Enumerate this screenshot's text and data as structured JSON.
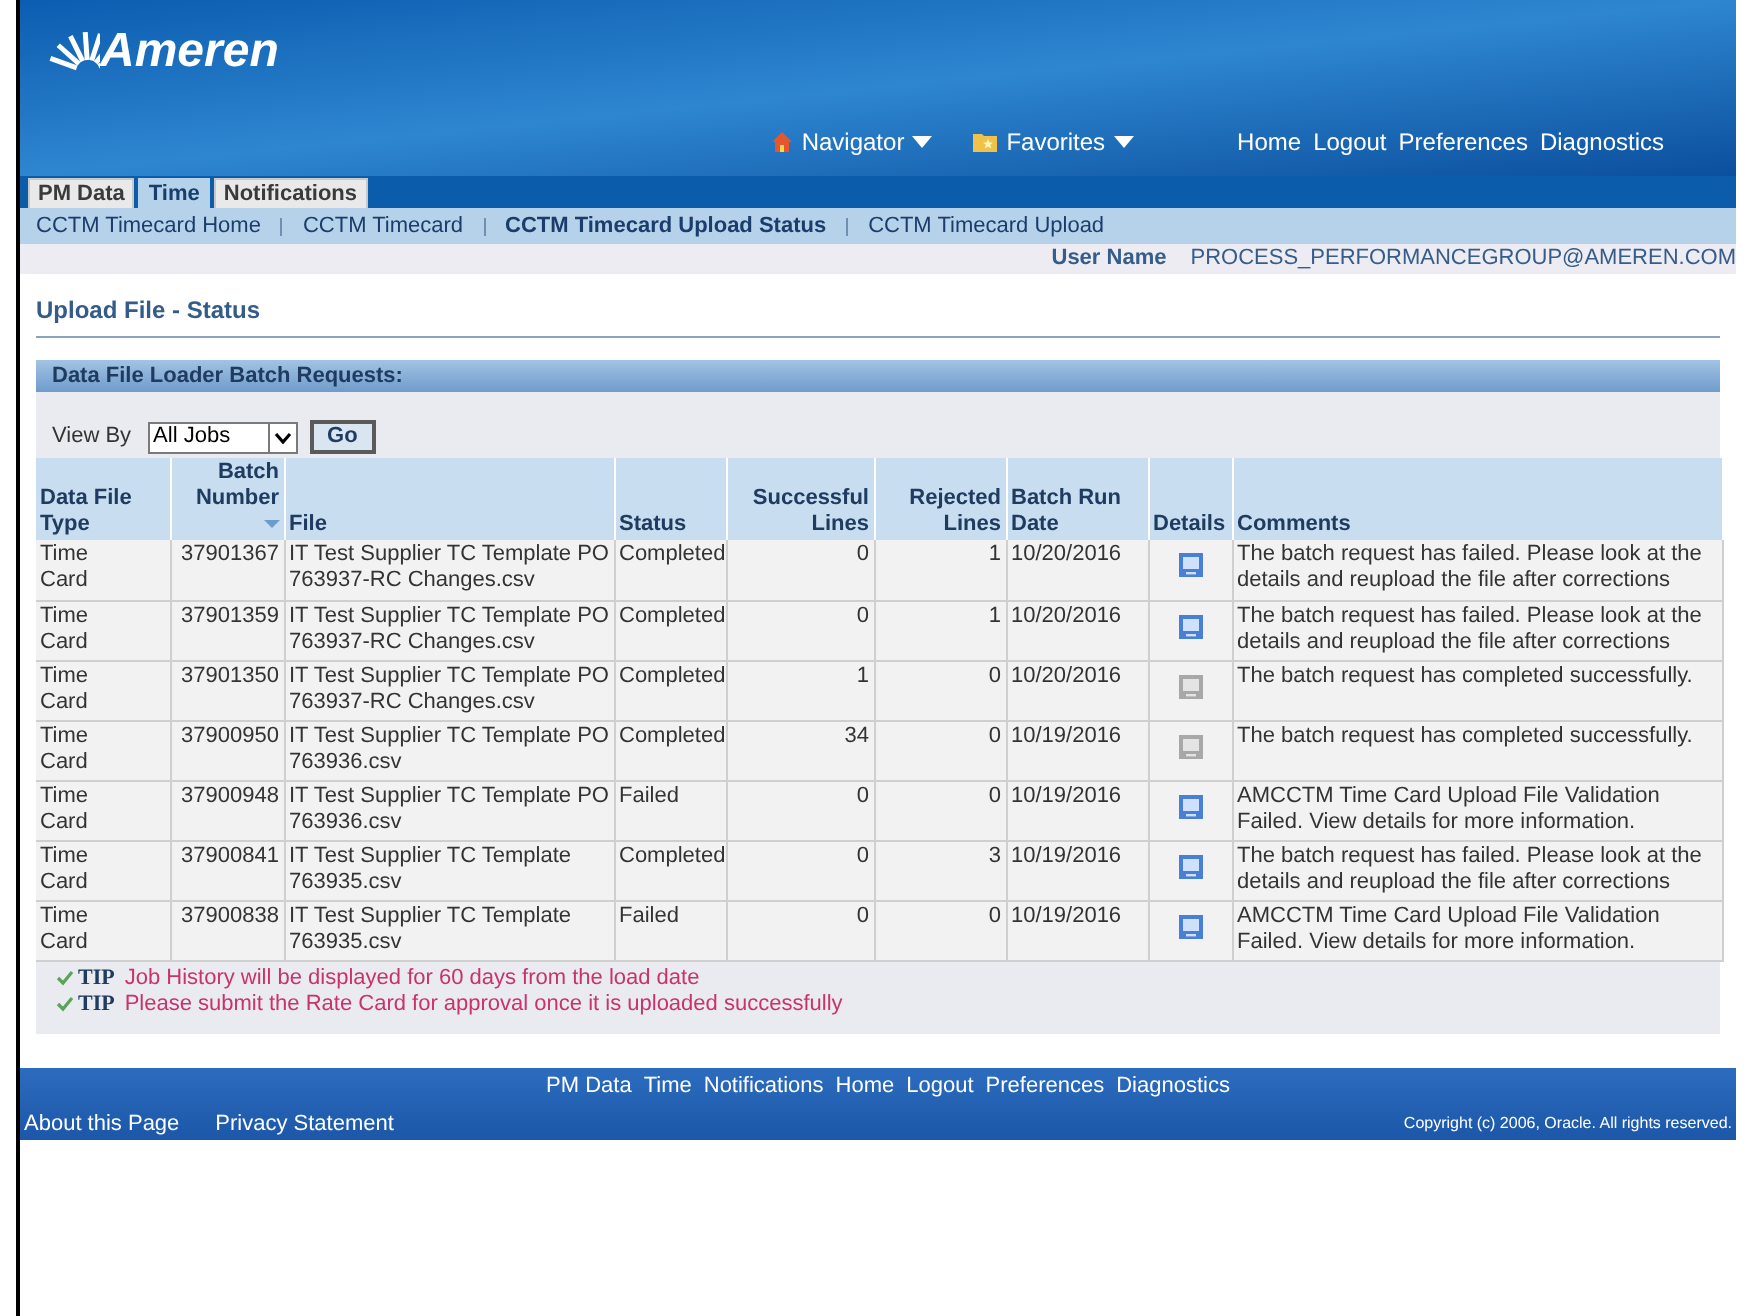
{
  "header": {
    "logo": "Ameren",
    "global_menus": [
      {
        "label": "Navigator",
        "kind": "home"
      },
      {
        "label": "Favorites",
        "kind": "favorites"
      }
    ],
    "global_links": [
      "Home",
      "Logout",
      "Preferences",
      "Diagnostics"
    ]
  },
  "tabs": [
    {
      "label": "PM Data",
      "selected": false
    },
    {
      "label": "Time",
      "selected": true
    },
    {
      "label": "Notifications",
      "selected": false
    }
  ],
  "subtabs": [
    {
      "label": "CCTM Timecard Home",
      "selected": false
    },
    {
      "label": "CCTM Timecard",
      "selected": false
    },
    {
      "label": "CCTM Timecard Upload Status",
      "selected": true
    },
    {
      "label": "CCTM Timecard Upload",
      "selected": false
    }
  ],
  "user": {
    "label": "User Name",
    "value": "PROCESS_PERFORMANCEGROUP@AMEREN.COM"
  },
  "page_title": "Upload File - Status",
  "panel": {
    "title": "Data File Loader Batch Requests:",
    "view_by": {
      "label": "View By",
      "value": "All Jobs",
      "button": "Go"
    },
    "columns": [
      {
        "label": "Data File Type",
        "sorted": false
      },
      {
        "label": "Batch Number",
        "sorted": true
      },
      {
        "label": "File",
        "sorted": false
      },
      {
        "label": "Status",
        "sorted": false
      },
      {
        "label": "Successful Lines",
        "sorted": false
      },
      {
        "label": "Rejected Lines",
        "sorted": false
      },
      {
        "label": "Batch Run Date",
        "sorted": false
      },
      {
        "label": "Details",
        "sorted": false
      },
      {
        "label": "Comments",
        "sorted": false
      }
    ],
    "rows": [
      {
        "type": "Time Card",
        "batch": "37901367",
        "file": "IT Test Supplier TC Template PO 763937-RC Changes.csv",
        "status": "Completed",
        "successful": "0",
        "rejected": "1",
        "date": "10/20/2016",
        "details_enabled": true,
        "comments": "The batch request has failed. Please look at the details and reupload the file after corrections"
      },
      {
        "type": "Time Card",
        "batch": "37901359",
        "file": "IT Test Supplier TC Template PO 763937-RC Changes.csv",
        "status": "Completed",
        "successful": "0",
        "rejected": "1",
        "date": "10/20/2016",
        "details_enabled": true,
        "comments": "The batch request has failed. Please look at the details and reupload the file after corrections"
      },
      {
        "type": "Time Card",
        "batch": "37901350",
        "file": "IT Test Supplier TC Template PO 763937-RC Changes.csv",
        "status": "Completed",
        "successful": "1",
        "rejected": "0",
        "date": "10/20/2016",
        "details_enabled": false,
        "comments": "The batch request has completed successfully."
      },
      {
        "type": "Time Card",
        "batch": "37900950",
        "file": "IT Test Supplier TC Template PO 763936.csv",
        "status": "Completed",
        "successful": "34",
        "rejected": "0",
        "date": "10/19/2016",
        "details_enabled": false,
        "comments": "The batch request has completed successfully."
      },
      {
        "type": "Time Card",
        "batch": "37900948",
        "file": "IT Test Supplier TC Template PO 763936.csv",
        "status": "Failed",
        "successful": "0",
        "rejected": "0",
        "date": "10/19/2016",
        "details_enabled": true,
        "comments": "AMCCTM Time Card Upload File Validation Failed. View details for more information."
      },
      {
        "type": "Time Card",
        "batch": "37900841",
        "file": "IT Test Supplier TC Template 763935.csv",
        "status": "Completed",
        "successful": "0",
        "rejected": "3",
        "date": "10/19/2016",
        "details_enabled": true,
        "comments": "The batch request has failed. Please look at the details and reupload the file after corrections"
      },
      {
        "type": "Time Card",
        "batch": "37900838",
        "file": "IT Test Supplier TC Template 763935.csv",
        "status": "Failed",
        "successful": "0",
        "rejected": "0",
        "date": "10/19/2016",
        "details_enabled": true,
        "comments": "AMCCTM Time Card Upload File Validation Failed. View details for more information."
      }
    ],
    "tips": [
      {
        "label": "TIP",
        "text": "Job History will be displayed for 60 days from the load date"
      },
      {
        "label": "TIP",
        "text": "Please submit the Rate Card for approval once it is uploaded successfully"
      }
    ]
  },
  "footer": {
    "links": [
      "PM Data",
      "Time",
      "Notifications",
      "Home",
      "Logout",
      "Preferences",
      "Diagnostics"
    ],
    "bottom_links": [
      "About this Page",
      "Privacy Statement"
    ],
    "copyright": "Copyright (c) 2006, Oracle. All rights reserved."
  }
}
